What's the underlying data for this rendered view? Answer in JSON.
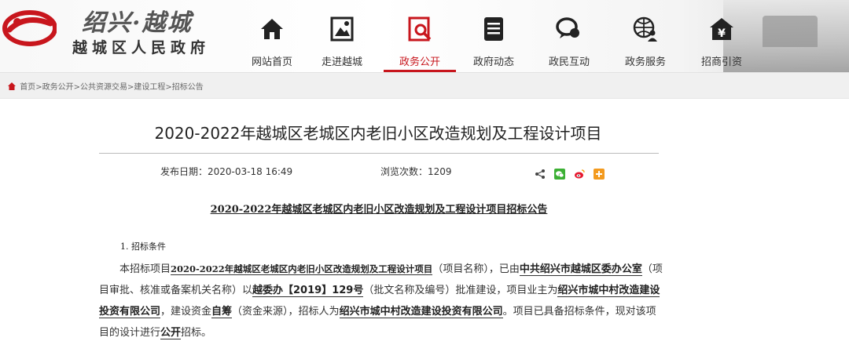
{
  "header": {
    "site_title": "绍兴·越城",
    "site_subtitle": "越城区人民政府"
  },
  "nav": {
    "items": [
      {
        "label": "网站首页",
        "icon": "home-icon"
      },
      {
        "label": "走进越城",
        "icon": "picture-icon"
      },
      {
        "label": "政务公开",
        "icon": "document-search-icon",
        "active": true
      },
      {
        "label": "政府动态",
        "icon": "news-list-icon"
      },
      {
        "label": "政民互动",
        "icon": "chat-bubbles-icon"
      },
      {
        "label": "政务服务",
        "icon": "globe-person-icon"
      },
      {
        "label": "招商引资",
        "icon": "money-house-icon"
      }
    ],
    "accent_color": "#c8161d"
  },
  "breadcrumb": {
    "items": [
      "首页",
      "政务公开",
      "公共资源交易",
      "建设工程",
      "招标公告"
    ],
    "separator": ">"
  },
  "article": {
    "title": "2020-2022年越城区老城区内老旧小区改造规划及工程设计项目",
    "date_label": "发布日期：",
    "date": "2020-03-18 16:49",
    "views_label": "浏览次数：",
    "views": "1209",
    "doc_title": "2020-2022年越城区老城区内老旧小区改造规划及工程设计项目招标公告",
    "section_1_heading": "1. 招标条件",
    "p1": {
      "t1": "本招标项目",
      "project_name": "2020-2022年越城区老城区内老旧小区改造规划及工程设计项目",
      "t2": "（项目名称），已由",
      "approver": "中共绍兴市越城区委办公室",
      "t3": "（项目审批、核准或备案机关名称）以",
      "approval_no": "越委办【2019】129号",
      "t4": "（批文名称及编号）批准建设，项目业主为",
      "owner": "绍兴市城中村改造建设投资有限公司",
      "t5": "，建设资金",
      "fund_source": "自筹",
      "t6": "（资金来源），招标人为",
      "tenderer": "绍兴市城中村改造建设投资有限公司",
      "t7": "。项目已具备招标条件，现对该项目的设计进行",
      "method": "公开",
      "t8": "招标。"
    }
  },
  "share_icons": [
    "share-icon",
    "wechat-icon",
    "weibo-icon",
    "add-icon"
  ]
}
